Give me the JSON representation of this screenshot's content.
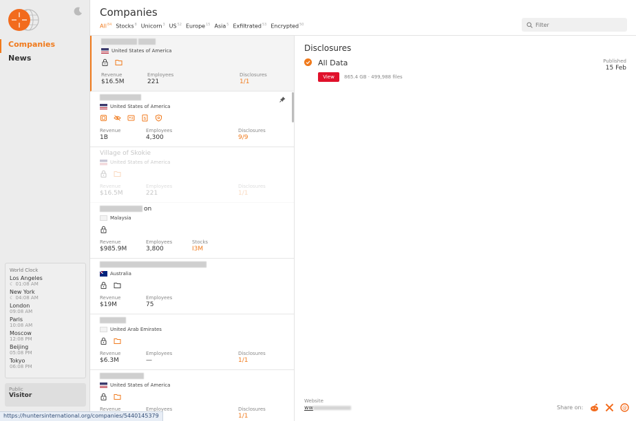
{
  "sidebar": {
    "nav": [
      {
        "label": "Companies",
        "active": true
      },
      {
        "label": "News",
        "active": false
      }
    ],
    "world_clock": {
      "title": "World Clock",
      "cities": [
        {
          "city": "Los Angeles",
          "time": "01:08 AM",
          "night": true
        },
        {
          "city": "New York",
          "time": "04:08 AM",
          "night": true
        },
        {
          "city": "London",
          "time": "09:08 AM",
          "night": false
        },
        {
          "city": "Paris",
          "time": "10:08 AM",
          "night": false
        },
        {
          "city": "Moscow",
          "time": "12:08 PM",
          "night": false
        },
        {
          "city": "Beijing",
          "time": "05:08 PM",
          "night": false
        },
        {
          "city": "Tokyo",
          "time": "06:08 PM",
          "night": false
        }
      ]
    },
    "user": {
      "role": "Public",
      "name": "Visitor"
    }
  },
  "status_url": "https://huntersinternational.org/companies/5440145379",
  "header": {
    "title": "Companies",
    "tabs": [
      {
        "label": "All",
        "count": "84",
        "active": true
      },
      {
        "label": "Stocks",
        "count": "8"
      },
      {
        "label": "Unicorn",
        "count": "3"
      },
      {
        "label": "US",
        "count": "52"
      },
      {
        "label": "Europe",
        "count": "15"
      },
      {
        "label": "Asia",
        "count": "5"
      },
      {
        "label": "Exfiltrated",
        "count": "53"
      },
      {
        "label": "Encrypted",
        "count": "50"
      }
    ],
    "filter_placeholder": "Filter"
  },
  "companies": [
    {
      "name": "",
      "country": "United States of America",
      "flag": "us",
      "icons": [
        "lock",
        "folder-orange"
      ],
      "stats": [
        {
          "label": "Revenue",
          "value": "$16.5M"
        },
        {
          "label": "Employees",
          "value": "221"
        },
        {
          "label": "Disclosures",
          "value": "1/1",
          "orange": true,
          "wide_gap": true
        }
      ],
      "selected": true
    },
    {
      "name": "",
      "country": "United States of America",
      "flag": "us",
      "icons": [
        "db",
        "eye",
        "id",
        "doc",
        "shield"
      ],
      "stats": [
        {
          "label": "Revenue",
          "value": "1B"
        },
        {
          "label": "Employees",
          "value": "4,300"
        },
        {
          "label": "Disclosures",
          "value": "9/9",
          "orange": true,
          "wide_gap": true
        }
      ],
      "pinned": true
    },
    {
      "name": "Village of Skokie",
      "country": "United States of America",
      "flag": "us",
      "icons": [
        "lock",
        "folder-orange"
      ],
      "stats": [
        {
          "label": "Revenue",
          "value": "$16.5M"
        },
        {
          "label": "Employees",
          "value": "221"
        },
        {
          "label": "Disclosures",
          "value": "1/1",
          "orange": true,
          "wide_gap": true
        }
      ],
      "faded": true
    },
    {
      "name": "on",
      "country": "Malaysia",
      "flag": "blank",
      "icons": [
        "lock"
      ],
      "stats": [
        {
          "label": "Revenue",
          "value": "$985.9M"
        },
        {
          "label": "Employees",
          "value": "3,800"
        },
        {
          "label": "Stocks",
          "value": "I3M",
          "orange": true
        }
      ]
    },
    {
      "name": "",
      "country": "Australia",
      "flag": "au",
      "icons": [
        "lock",
        "folder-grey"
      ],
      "stats": [
        {
          "label": "Revenue",
          "value": "$19M"
        },
        {
          "label": "Employees",
          "value": "75"
        }
      ]
    },
    {
      "name": "",
      "country": "United Arab Emirates",
      "flag": "blank",
      "icons": [
        "lock",
        "folder-orange"
      ],
      "stats": [
        {
          "label": "Revenue",
          "value": "$6.3M"
        },
        {
          "label": "Employees",
          "value": "—"
        },
        {
          "label": "Disclosures",
          "value": "1/1",
          "orange": true,
          "wide_gap": true
        }
      ]
    },
    {
      "name": "",
      "country": "United States of America",
      "flag": "us",
      "icons": [
        "lock",
        "folder-orange"
      ],
      "stats": [
        {
          "label": "Revenue",
          "value": ""
        },
        {
          "label": "Employees",
          "value": ""
        },
        {
          "label": "Disclosures",
          "value": "1/1",
          "orange": true,
          "wide_gap": true
        }
      ]
    }
  ],
  "detail": {
    "title": "Disclosures",
    "item_label": "All Data",
    "published_label": "Published",
    "published_date": "15 Feb",
    "view_label": "View",
    "size_info": "865.4 GB · 499,988 files",
    "website_label": "Website",
    "website_value": "ww",
    "share_label": "Share on:"
  },
  "colors": {
    "accent": "#f07a1c",
    "view_button": "#e0112b"
  }
}
